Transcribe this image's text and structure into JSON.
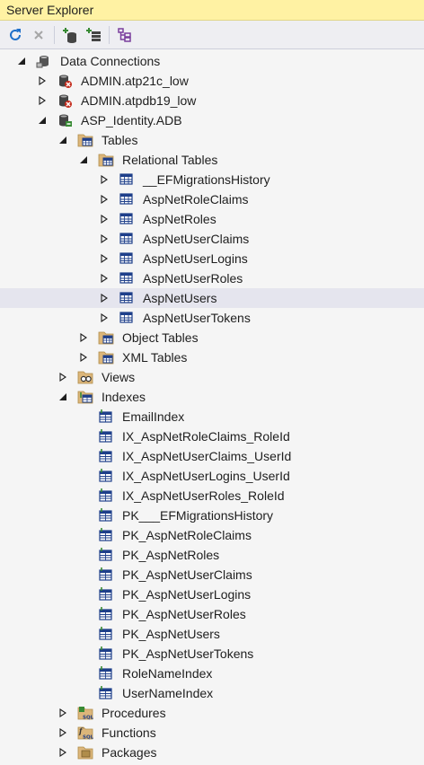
{
  "window": {
    "title": "Server Explorer"
  },
  "toolbar": {
    "buttons": [
      {
        "name": "refresh-button",
        "icon": "refresh-icon",
        "enabled": true
      },
      {
        "name": "stop-button",
        "icon": "stop-icon",
        "enabled": false
      },
      {
        "name": "connect-to-database-button",
        "icon": "connect-database-icon",
        "enabled": true
      },
      {
        "name": "connect-to-server-button",
        "icon": "connect-server-icon",
        "enabled": true
      },
      {
        "name": "connect-to-sharepoint-button",
        "icon": "sharepoint-icon",
        "enabled": true
      }
    ]
  },
  "tree": {
    "nodes": [
      {
        "label": "Data Connections",
        "level": 0,
        "expander": "expanded",
        "icon": "data-connections-icon"
      },
      {
        "label": "ADMIN.atp21c_low",
        "level": 1,
        "expander": "collapsed",
        "icon": "db-error-icon"
      },
      {
        "label": "ADMIN.atpdb19_low",
        "level": 1,
        "expander": "collapsed",
        "icon": "db-error-icon"
      },
      {
        "label": "ASP_Identity.ADB",
        "level": 1,
        "expander": "expanded",
        "icon": "db-connected-icon"
      },
      {
        "label": "Tables",
        "level": 2,
        "expander": "expanded",
        "icon": "folder-table-icon"
      },
      {
        "label": "Relational Tables",
        "level": 3,
        "expander": "expanded",
        "icon": "folder-table-icon"
      },
      {
        "label": "__EFMigrationsHistory",
        "level": 4,
        "expander": "collapsed",
        "icon": "table-icon"
      },
      {
        "label": "AspNetRoleClaims",
        "level": 4,
        "expander": "collapsed",
        "icon": "table-icon"
      },
      {
        "label": "AspNetRoles",
        "level": 4,
        "expander": "collapsed",
        "icon": "table-icon"
      },
      {
        "label": "AspNetUserClaims",
        "level": 4,
        "expander": "collapsed",
        "icon": "table-icon"
      },
      {
        "label": "AspNetUserLogins",
        "level": 4,
        "expander": "collapsed",
        "icon": "table-icon"
      },
      {
        "label": "AspNetUserRoles",
        "level": 4,
        "expander": "collapsed",
        "icon": "table-icon"
      },
      {
        "label": "AspNetUsers",
        "level": 4,
        "expander": "collapsed",
        "icon": "table-icon",
        "selected": true
      },
      {
        "label": "AspNetUserTokens",
        "level": 4,
        "expander": "collapsed",
        "icon": "table-icon"
      },
      {
        "label": "Object Tables",
        "level": 3,
        "expander": "collapsed",
        "icon": "folder-table-icon"
      },
      {
        "label": "XML Tables",
        "level": 3,
        "expander": "collapsed",
        "icon": "folder-table-icon"
      },
      {
        "label": "Views",
        "level": 2,
        "expander": "collapsed",
        "icon": "folder-view-icon"
      },
      {
        "label": "Indexes",
        "level": 2,
        "expander": "expanded",
        "icon": "folder-index-icon"
      },
      {
        "label": "EmailIndex",
        "level": 3,
        "expander": "none",
        "icon": "index-icon"
      },
      {
        "label": "IX_AspNetRoleClaims_RoleId",
        "level": 3,
        "expander": "none",
        "icon": "index-icon"
      },
      {
        "label": "IX_AspNetUserClaims_UserId",
        "level": 3,
        "expander": "none",
        "icon": "index-icon"
      },
      {
        "label": "IX_AspNetUserLogins_UserId",
        "level": 3,
        "expander": "none",
        "icon": "index-icon"
      },
      {
        "label": "IX_AspNetUserRoles_RoleId",
        "level": 3,
        "expander": "none",
        "icon": "index-icon"
      },
      {
        "label": "PK___EFMigrationsHistory",
        "level": 3,
        "expander": "none",
        "icon": "index-icon"
      },
      {
        "label": "PK_AspNetRoleClaims",
        "level": 3,
        "expander": "none",
        "icon": "index-icon"
      },
      {
        "label": "PK_AspNetRoles",
        "level": 3,
        "expander": "none",
        "icon": "index-icon"
      },
      {
        "label": "PK_AspNetUserClaims",
        "level": 3,
        "expander": "none",
        "icon": "index-icon"
      },
      {
        "label": "PK_AspNetUserLogins",
        "level": 3,
        "expander": "none",
        "icon": "index-icon"
      },
      {
        "label": "PK_AspNetUserRoles",
        "level": 3,
        "expander": "none",
        "icon": "index-icon"
      },
      {
        "label": "PK_AspNetUsers",
        "level": 3,
        "expander": "none",
        "icon": "index-icon"
      },
      {
        "label": "PK_AspNetUserTokens",
        "level": 3,
        "expander": "none",
        "icon": "index-icon"
      },
      {
        "label": "RoleNameIndex",
        "level": 3,
        "expander": "none",
        "icon": "index-icon"
      },
      {
        "label": "UserNameIndex",
        "level": 3,
        "expander": "none",
        "icon": "index-icon"
      },
      {
        "label": "Procedures",
        "level": 2,
        "expander": "collapsed",
        "icon": "folder-procedure-icon"
      },
      {
        "label": "Functions",
        "level": 2,
        "expander": "collapsed",
        "icon": "folder-function-icon"
      },
      {
        "label": "Packages",
        "level": 2,
        "expander": "collapsed",
        "icon": "folder-package-icon"
      }
    ]
  },
  "colors": {
    "title_bar": "#fff2a3",
    "selection": "#e5e5ee",
    "folder": "#dcb67a",
    "table": "#1e3f8a",
    "db": "#555555"
  }
}
